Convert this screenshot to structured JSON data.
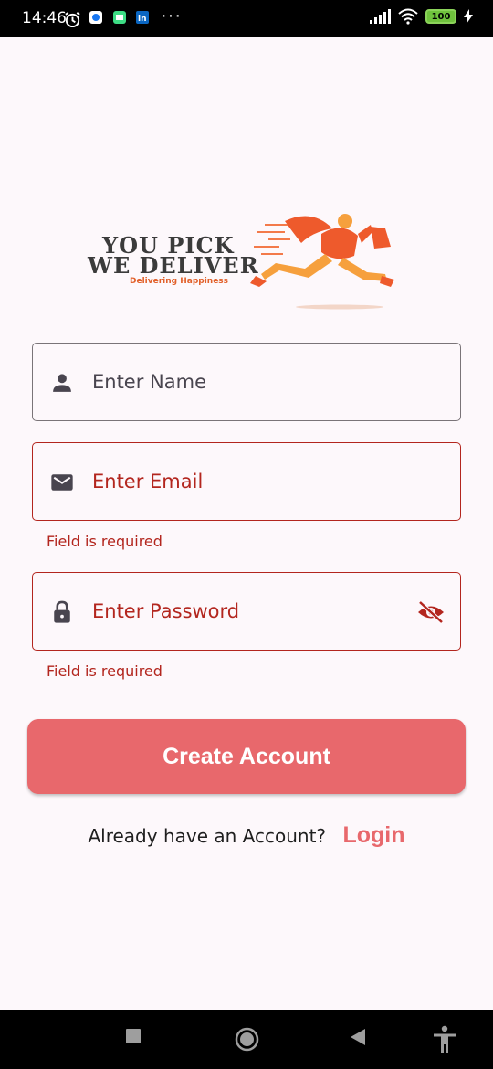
{
  "status_bar": {
    "time": "14:46",
    "battery": "100",
    "dots": "···"
  },
  "logo": {
    "line1": "YOU PICK",
    "line2": "WE DELIVER",
    "tagline": "Delivering Happiness"
  },
  "form": {
    "name": {
      "placeholder": "Enter Name"
    },
    "email": {
      "placeholder": "Enter Email",
      "error": "Field is required"
    },
    "password": {
      "placeholder": "Enter Password",
      "error": "Field is required"
    }
  },
  "actions": {
    "create_label": "Create Account",
    "login_prompt": "Already have an Account?",
    "login_label": "Login"
  },
  "colors": {
    "accent": "#e8686c",
    "error": "#b3261e",
    "background": "#fdf8fb"
  }
}
